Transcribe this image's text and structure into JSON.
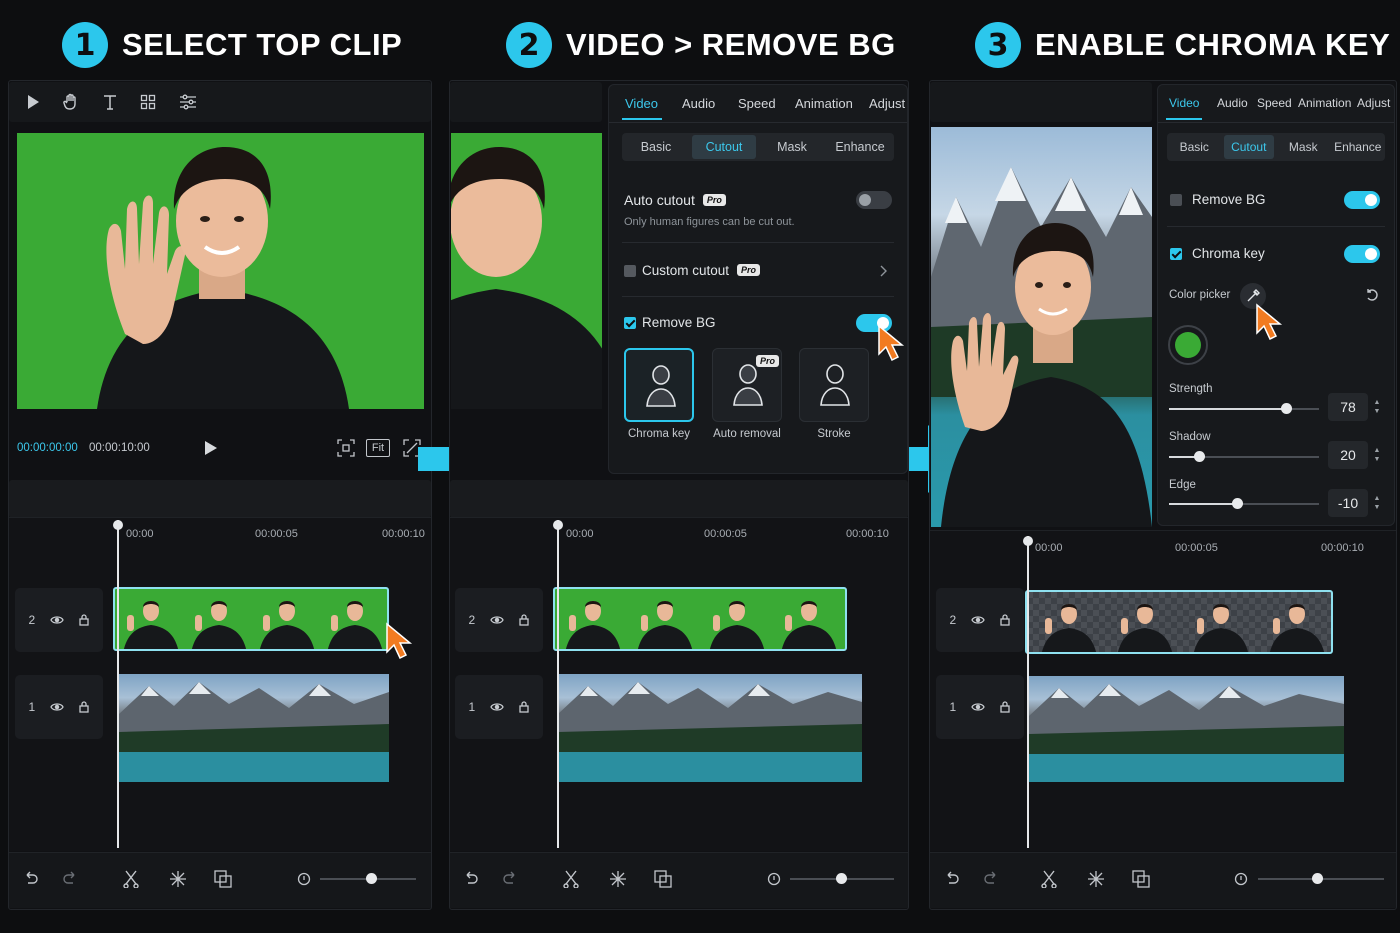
{
  "steps": [
    {
      "num": "1",
      "title": "SELECT TOP CLIP"
    },
    {
      "num": "2",
      "title": "VIDEO > REMOVE BG"
    },
    {
      "num": "3",
      "title": "ENABLE CHROMA KEY"
    }
  ],
  "player": {
    "current": "00:00:00:00",
    "duration": "00:00:10:00",
    "fit": "Fit"
  },
  "ruler": [
    "00:00",
    "00:00:05",
    "00:00:10"
  ],
  "tracks": {
    "top": "2",
    "bottom": "1"
  },
  "tabs": [
    "Video",
    "Audio",
    "Speed",
    "Animation",
    "Adjust"
  ],
  "subtabs": [
    "Basic",
    "Cutout",
    "Mask",
    "Enhance"
  ],
  "panel2": {
    "auto_cutout": "Auto cutout",
    "auto_cutout_hint": "Only human figures can be cut out.",
    "custom_cutout": "Custom cutout",
    "remove_bg": "Remove BG",
    "pro": "Pro",
    "options": [
      "Chroma key",
      "Auto removal",
      "Stroke"
    ]
  },
  "panel3": {
    "remove_bg": "Remove BG",
    "chroma_key": "Chroma key",
    "color_picker": "Color picker",
    "picked_color": "#3aaa35",
    "sliders": [
      {
        "label": "Strength",
        "value": "78",
        "fraction": 0.78
      },
      {
        "label": "Shadow",
        "value": "20",
        "fraction": 0.2
      },
      {
        "label": "Edge",
        "value": "-10",
        "fraction": 0.45
      }
    ]
  },
  "colors": {
    "accent": "#2cc7ec",
    "cursor": "#f27b21",
    "chroma_green": "#3aaa35"
  }
}
